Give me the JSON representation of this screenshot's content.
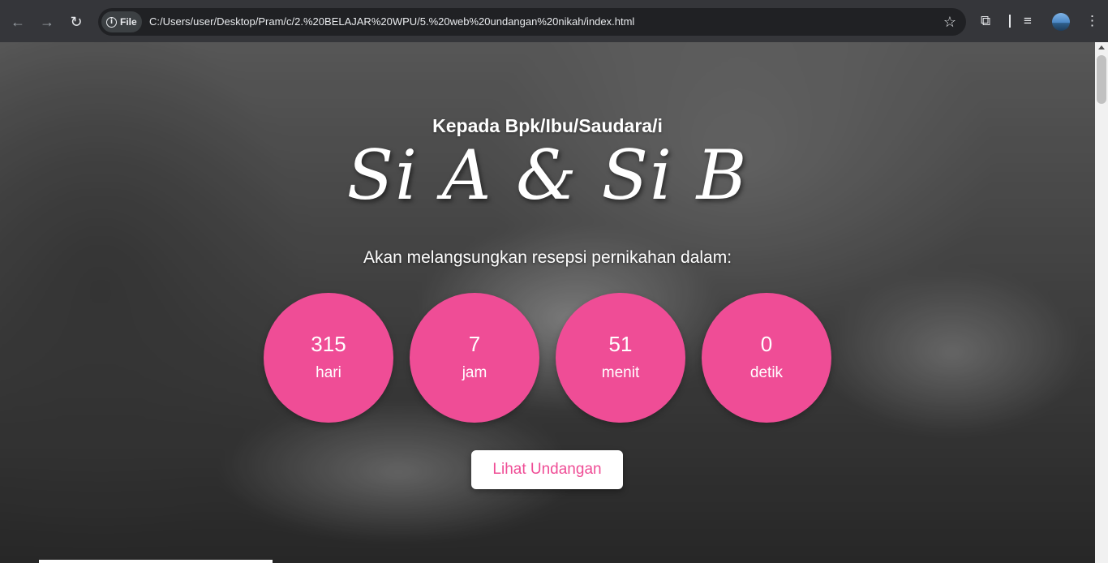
{
  "browser": {
    "site_chip_label": "File",
    "url": "C:/Users/user/Desktop/Pram/c/2.%20BELAJAR%20WPU/5.%20web%20undangan%20nikah/index.html",
    "icons": {
      "back": "arrow-left-icon",
      "forward": "arrow-right-icon",
      "reload": "reload-icon",
      "info": "info-icon",
      "bookmark": "star-icon",
      "extensions": "puzzle-icon",
      "media": "media-queue-icon",
      "menu": "kebab-menu-icon"
    }
  },
  "hero": {
    "greeting": "Kepada Bpk/Ibu/Saudara/i",
    "couple": "Si A & Si B",
    "subtitle": "Akan melangsungkan resepsi pernikahan dalam:",
    "countdown": [
      {
        "value": "315",
        "unit": "hari"
      },
      {
        "value": "7",
        "unit": "jam"
      },
      {
        "value": "51",
        "unit": "menit"
      },
      {
        "value": "0",
        "unit": "detik"
      }
    ],
    "cta_label": "Lihat Undangan"
  },
  "colors": {
    "accent_pink": "#ef4d96",
    "text_white": "#ffffff",
    "browser_toolbar": "#35363a"
  }
}
